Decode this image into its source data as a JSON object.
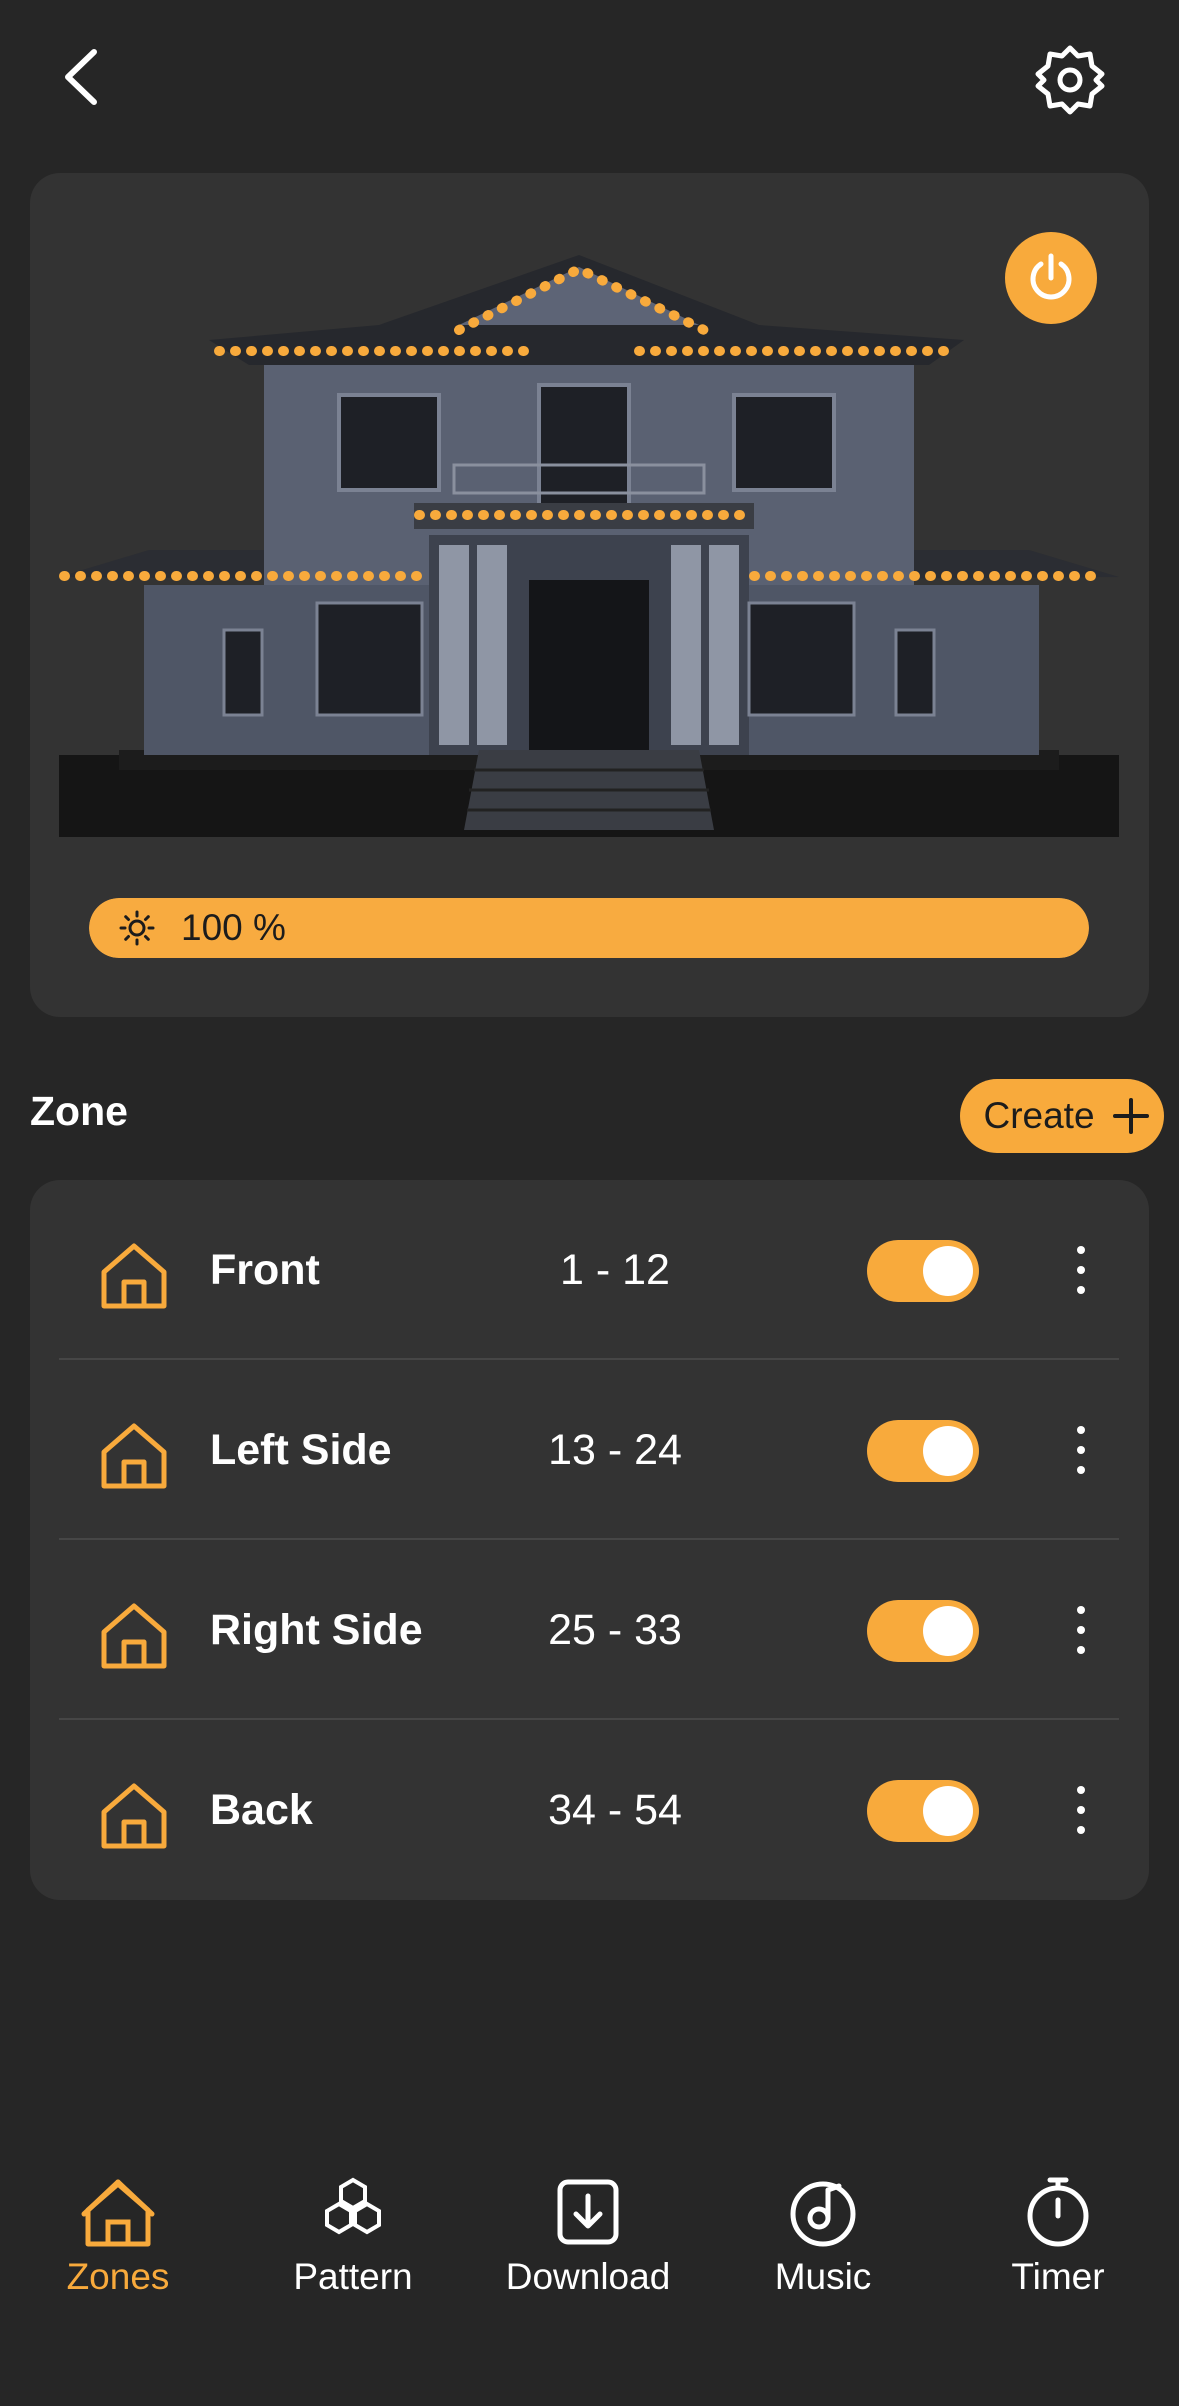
{
  "header": {
    "back_icon": "chevron-left-icon",
    "settings_icon": "gear-icon"
  },
  "hero": {
    "power_icon": "power-icon",
    "image": "house-with-lights",
    "brightness": {
      "value": 1.0,
      "label": "100 %",
      "icon": "sun-icon"
    }
  },
  "zones": {
    "title": "Zone",
    "create_label": "Create",
    "create_icon": "plus-icon",
    "items": [
      {
        "name": "Front",
        "range": "1 - 12",
        "enabled": true
      },
      {
        "name": "Left Side",
        "range": "13 - 24",
        "enabled": true
      },
      {
        "name": "Right Side",
        "range": "25 - 33",
        "enabled": true
      },
      {
        "name": "Back",
        "range": "34 - 54",
        "enabled": true
      }
    ]
  },
  "nav": {
    "items": [
      {
        "label": "Zones",
        "icon": "home-icon",
        "active": true
      },
      {
        "label": "Pattern",
        "icon": "pattern-icon",
        "active": false
      },
      {
        "label": "Download",
        "icon": "download-icon",
        "active": false
      },
      {
        "label": "Music",
        "icon": "music-icon",
        "active": false
      },
      {
        "label": "Timer",
        "icon": "timer-icon",
        "active": false
      }
    ]
  },
  "colors": {
    "background": "#262626",
    "card": "#333333",
    "accent": "#f8aa3c",
    "text": "#ffffff"
  }
}
